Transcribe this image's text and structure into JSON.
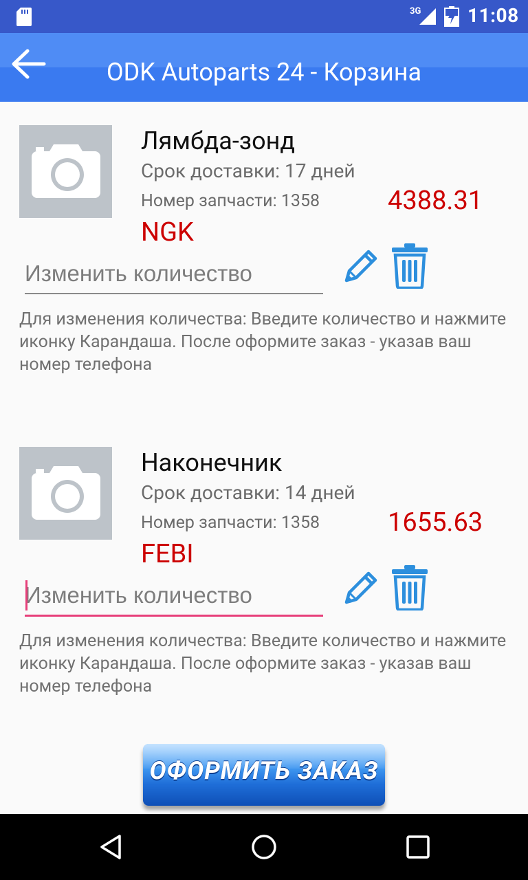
{
  "status_bar": {
    "network": "3G",
    "time": "11:08"
  },
  "app_bar": {
    "title": "ODK Autoparts 24 - Корзина",
    "back_icon": "arrow-left-icon"
  },
  "cart": {
    "items": [
      {
        "name": "Лямбда-зонд",
        "delivery": "Срок доставки: 17 дней",
        "part_number": "Номер запчасти: 1358",
        "price": "4388.31",
        "brand": "NGK",
        "qty_placeholder": "Изменить количество",
        "hint": "Для изменения количества: Введите количество и нажмите иконку Карандаша. После оформите заказ - указав ваш номер телефона"
      },
      {
        "name": "Наконечник",
        "delivery": "Срок доставки: 14 дней",
        "part_number": "Номер запчасти: 1358",
        "price": "1655.63",
        "brand": "FEBI",
        "qty_placeholder": "Изменить количество",
        "hint": "Для изменения количества: Введите количество и нажмите иконку Карандаша. После оформите заказ - указав ваш номер телефона"
      }
    ]
  },
  "order_button": {
    "label": "ОФОРМИТЬ ЗАКАЗ"
  },
  "colors": {
    "status_bar": "#3758c9",
    "app_bar": "#4f8cf5",
    "price_red": "#cc0000",
    "icon_blue": "#2d8fdd",
    "focus_pink": "#e73f7a"
  }
}
